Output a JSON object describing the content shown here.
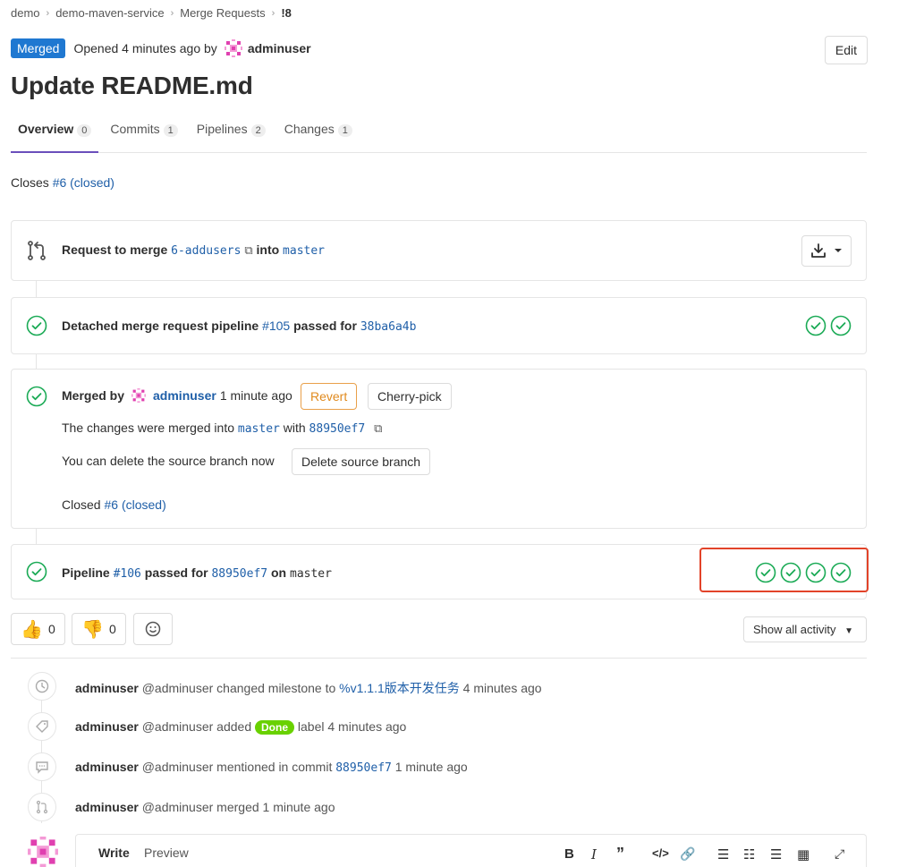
{
  "breadcrumb": [
    "demo",
    "demo-maven-service",
    "Merge Requests",
    "!8"
  ],
  "header": {
    "status": "Merged",
    "opened_text": "Opened 4 minutes ago by",
    "author": "adminuser",
    "edit_label": "Edit",
    "title": "Update README.md"
  },
  "tabs": [
    {
      "label": "Overview",
      "count": "0"
    },
    {
      "label": "Commits",
      "count": "1"
    },
    {
      "label": "Pipelines",
      "count": "2"
    },
    {
      "label": "Changes",
      "count": "1"
    }
  ],
  "closes": {
    "prefix": "Closes",
    "issue": "#6 (closed)"
  },
  "merge_request": {
    "prefix": "Request to merge",
    "source": "6-addusers",
    "middle": "into",
    "target": "master"
  },
  "detached_pipeline": {
    "prefix": "Detached merge request pipeline",
    "id": "#105",
    "mid": "passed for",
    "commit": "38ba6a4b"
  },
  "merged": {
    "prefix": "Merged by",
    "user": "adminuser",
    "time": "1 minute ago",
    "revert_label": "Revert",
    "cherry_label": "Cherry-pick",
    "changes_prefix": "The changes were merged into",
    "changes_branch": "master",
    "changes_with": "with",
    "changes_commit": "88950ef7",
    "delete_text": "You can delete the source branch now",
    "delete_label": "Delete source branch",
    "closed_prefix": "Closed",
    "closed_issue": "#6 (closed)"
  },
  "pipeline": {
    "prefix": "Pipeline",
    "id": "#106",
    "mid": "passed for",
    "commit": "88950ef7",
    "on": "on",
    "branch": "master"
  },
  "awards": {
    "thumbsup": "0",
    "thumbsdown": "0"
  },
  "show_activity": "Show all activity",
  "activity": [
    {
      "user": "adminuser",
      "handle": "@adminuser",
      "action": "changed milestone to",
      "link": "%v1.1.1版本开发任务",
      "time": "4 minutes ago"
    },
    {
      "user": "adminuser",
      "handle": "@adminuser",
      "action": "added",
      "label": "Done",
      "suffix": "label",
      "time": "4 minutes ago"
    },
    {
      "user": "adminuser",
      "handle": "@adminuser",
      "action": "mentioned in commit",
      "link": "88950ef7",
      "time": "1 minute ago"
    },
    {
      "user": "adminuser",
      "handle": "@adminuser",
      "action": "merged",
      "time": "1 minute ago"
    }
  ],
  "comment": {
    "write": "Write",
    "preview": "Preview"
  },
  "colors": {
    "accent": "#1f78d1",
    "success": "#1aaa55",
    "highlight": "#e24329",
    "tab_active": "#6b4fbb",
    "done_label": "#69d100"
  }
}
